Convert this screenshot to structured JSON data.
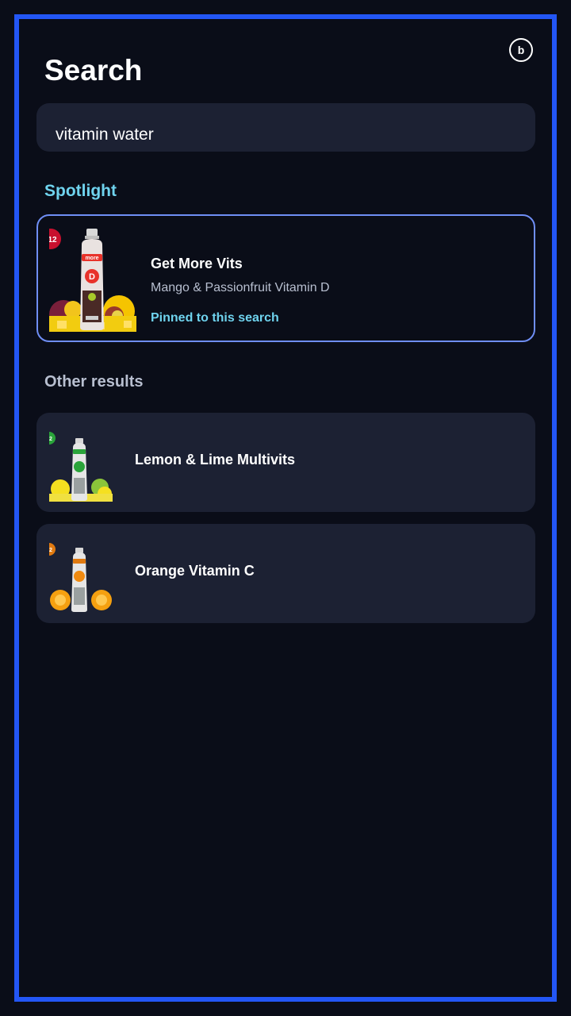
{
  "header": {
    "title": "Search",
    "avatar_letter": "b"
  },
  "search": {
    "value": "vitamin water"
  },
  "spotlight": {
    "heading": "Spotlight",
    "card": {
      "badge": "12",
      "title": "Get More Vits",
      "subtitle": "Mango & Passionfruit Vitamin D",
      "pinned_text": "Pinned to this search",
      "bottle_brand": "more",
      "bottle_letter": "D",
      "badge_color": "#c8102e",
      "accent_color": "#e8322a"
    }
  },
  "other_results": {
    "heading": "Other results",
    "items": [
      {
        "title": "Lemon & Lime Multivits",
        "badge": "2",
        "badge_color": "#2aa43a"
      },
      {
        "title": "Orange Vitamin C",
        "badge": "2",
        "badge_color": "#e07a10"
      }
    ]
  },
  "colors": {
    "frame": "#2356f5",
    "background": "#0a0d18",
    "card": "#1c2133",
    "accent": "#6fd3ee",
    "spotlight_border": "#6f8ef5"
  }
}
